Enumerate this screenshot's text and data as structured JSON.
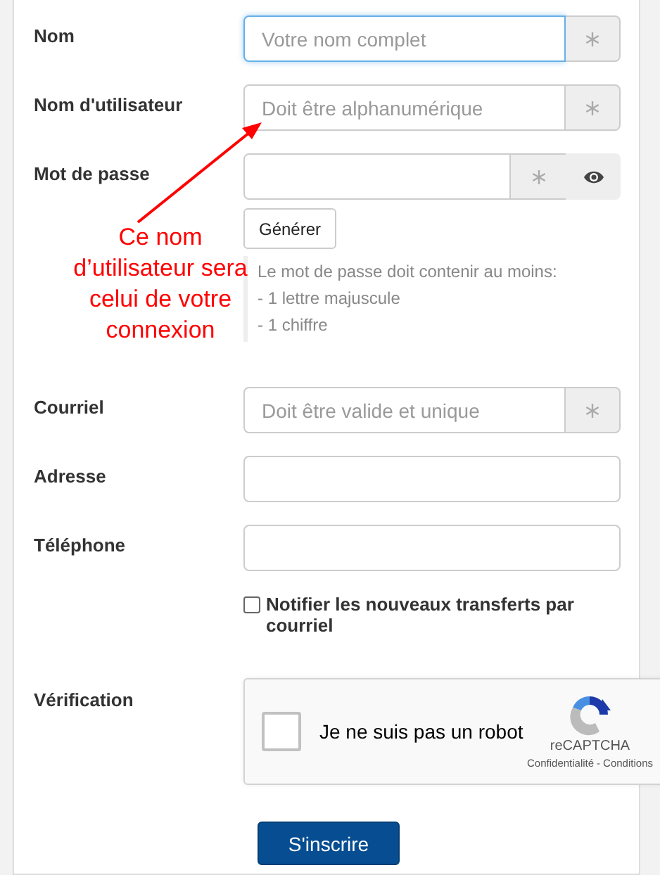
{
  "fields": [
    {
      "label": "Nom",
      "kind": "text",
      "placeholder": "Votre nom complet",
      "required": true,
      "focused": true
    },
    {
      "label": "Nom d'utilisateur",
      "kind": "text",
      "placeholder": "Doit être alphanumérique",
      "required": true,
      "focused": false
    },
    {
      "label": "Mot de passe",
      "kind": "password",
      "required": true,
      "focused": false,
      "generate_button": "Générer",
      "help": [
        "Le mot de passe doit contenir au moins:",
        "- 1 lettre majuscule",
        "- 1 chiffre"
      ]
    },
    {
      "label": "Courriel",
      "kind": "text",
      "placeholder": "Doit être valide et unique",
      "required": true,
      "focused": false
    },
    {
      "label": "Adresse",
      "kind": "text",
      "required": false,
      "focused": false
    },
    {
      "label": "Téléphone",
      "kind": "text",
      "required": false,
      "focused": false
    }
  ],
  "notify": {
    "label": "Notifier les nouveaux transferts par courriel",
    "checked": false
  },
  "verification": {
    "label": "Vérification",
    "captcha_label": "Je ne suis pas un robot",
    "checked": false,
    "brand": "reCAPTCHA",
    "links": [
      "Confidentialité",
      "Conditions"
    ],
    "link_separator": "-"
  },
  "submit": "S'inscrire",
  "annotation": {
    "text": "Ce nom d’utilisateur sera celui de votre connexion"
  }
}
